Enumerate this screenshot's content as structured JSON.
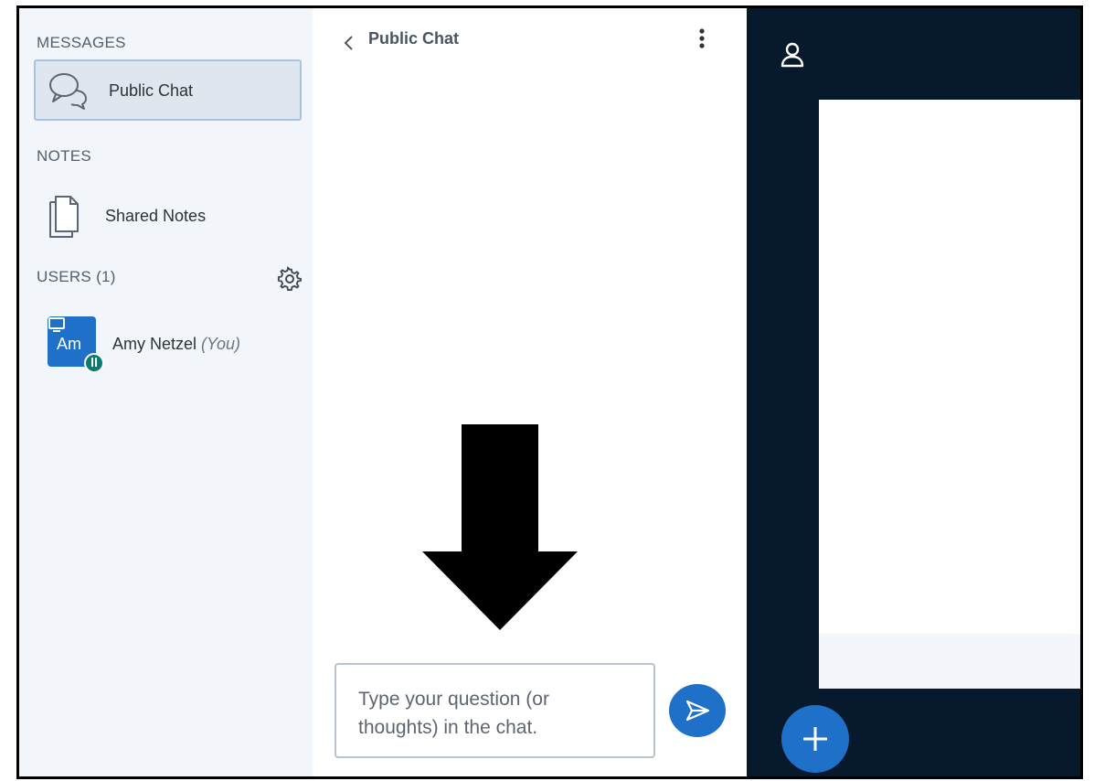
{
  "sidebar": {
    "messages_label": "MESSAGES",
    "public_chat_label": "Public Chat",
    "notes_label": "NOTES",
    "shared_notes_label": "Shared Notes",
    "users_label": "USERS (1)",
    "user": {
      "initials": "Am",
      "name": "Amy Netzel",
      "you_tag": "(You)"
    }
  },
  "chat": {
    "title": "Public Chat",
    "input_text": "Type your question (or thoughts) in the chat."
  },
  "colors": {
    "accent": "#1e70c8",
    "sidebar_bg": "#f2f5f9",
    "presentation_bg": "#07192c",
    "audio_badge": "#0b7a6f"
  },
  "icons": [
    "chat-bubbles-icon",
    "document-icon",
    "gear-icon",
    "screen-icon",
    "headset-icon",
    "chevron-left-icon",
    "kebab-menu-icon",
    "send-icon",
    "user-icon",
    "plus-icon",
    "down-arrow"
  ]
}
